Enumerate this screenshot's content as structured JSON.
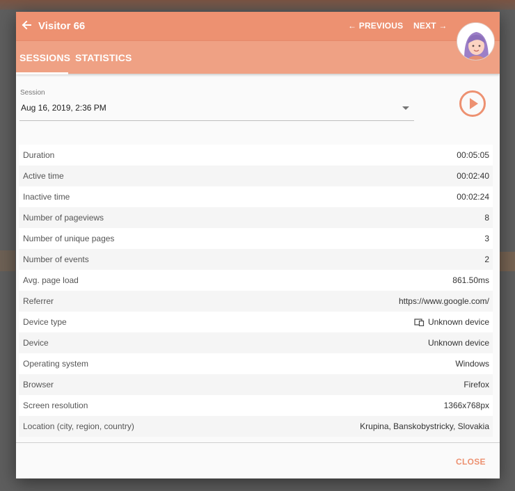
{
  "header": {
    "title": "Visitor 66",
    "previous_label": "← PREVIOUS",
    "next_label": "NEXT →"
  },
  "tabs": [
    {
      "label": "SESSIONS",
      "active": true
    },
    {
      "label": "STATISTICS",
      "active": false
    }
  ],
  "session": {
    "label": "Session",
    "value": "Aug 16, 2019, 2:36 PM"
  },
  "stats": [
    {
      "label": "Duration",
      "value": "00:05:05"
    },
    {
      "label": "Active time",
      "value": "00:02:40"
    },
    {
      "label": "Inactive time",
      "value": "00:02:24"
    },
    {
      "label": "Number of pageviews",
      "value": "8"
    },
    {
      "label": "Number of unique pages",
      "value": "3"
    },
    {
      "label": "Number of events",
      "value": "2"
    },
    {
      "label": "Avg. page load",
      "value": "861.50ms"
    },
    {
      "label": "Referrer",
      "value": "https://www.google.com/"
    },
    {
      "label": "Device type",
      "value": "Unknown device",
      "icon": "devices-icon"
    },
    {
      "label": "Device",
      "value": "Unknown device"
    },
    {
      "label": "Operating system",
      "value": "Windows"
    },
    {
      "label": "Browser",
      "value": "Firefox"
    },
    {
      "label": "Screen resolution",
      "value": "1366x768px"
    },
    {
      "label": "Location (city, region, country)",
      "value": "Krupina, Banskobystricky, Slovakia"
    }
  ],
  "footer": {
    "close_label": "CLOSE"
  },
  "colors": {
    "accent": "#ed9171",
    "tabbar": "#efa184"
  }
}
